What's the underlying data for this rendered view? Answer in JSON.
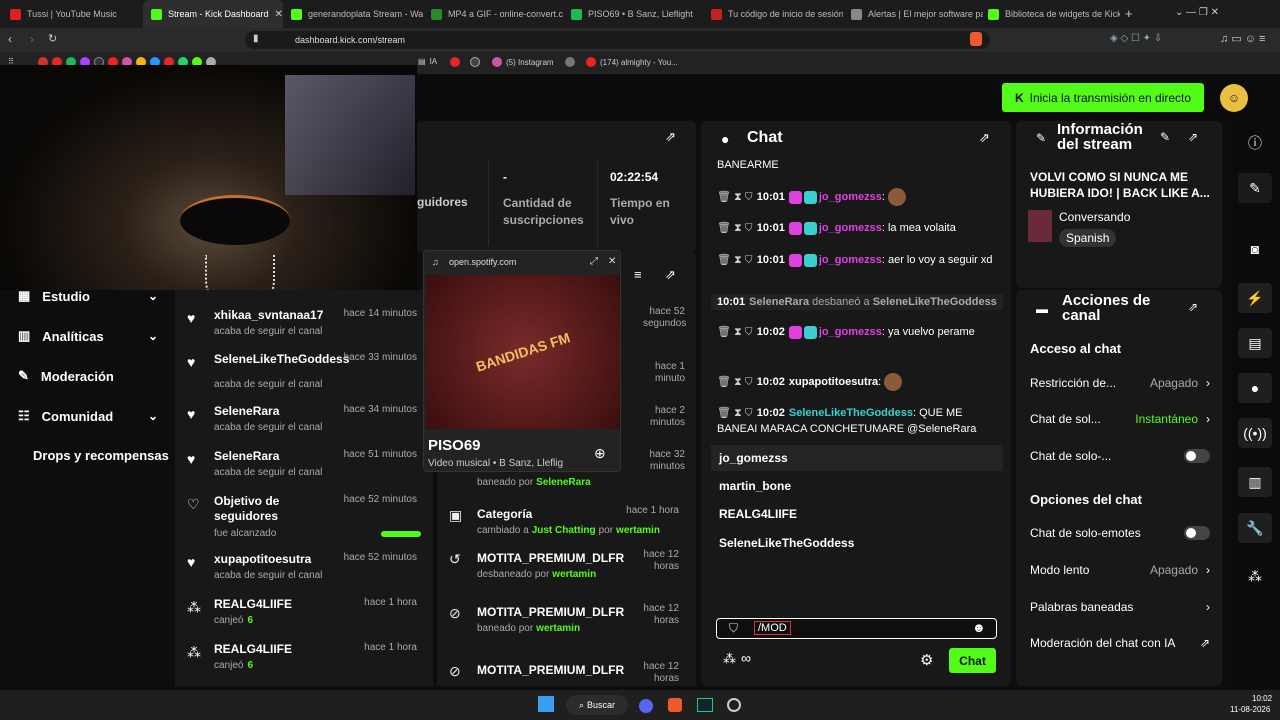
{
  "browser": {
    "tabs": [
      {
        "label": "Tussi | YouTube Music",
        "color": "#e02020"
      },
      {
        "label": "Stream - Kick Dashboard",
        "color": "#53fc18",
        "active": true
      },
      {
        "label": "generandoplata Stream - Wat",
        "color": "#53fc18"
      },
      {
        "label": "MP4 a GIF - online-convert.co",
        "color": "#2a8a2a"
      },
      {
        "label": "PISO69 • B Sanz, Lleflight",
        "color": "#1db954"
      },
      {
        "label": "Tu código de inicio de sesión",
        "color": "#c5221f"
      },
      {
        "label": "Alertas | El mejor software pa",
        "color": "#888888"
      },
      {
        "label": "Biblioteca de widgets de Kick",
        "color": "#53fc18"
      }
    ],
    "url": "dashboard.kick.com/stream",
    "bookmarks": [
      {
        "label": "IA"
      },
      {
        "label": "(5) Instagram"
      },
      {
        "label": "(174) almighty - You..."
      }
    ]
  },
  "topbar": {
    "go_live": "Inicia la transmisión en directo"
  },
  "sidebar": {
    "items": [
      {
        "label": "Estudio",
        "chev": "⌄"
      },
      {
        "label": "Analíticas",
        "chev": "⌄"
      },
      {
        "label": "Moderación",
        "chev": ""
      },
      {
        "label": "Comunidad",
        "chev": "⌄"
      },
      {
        "label": "Drops y recompensas",
        "chev": ""
      }
    ]
  },
  "stats": {
    "followers_label": "guidores",
    "subs_value": "-",
    "subs_label": "Cantidad de suscripciones",
    "live_value": "02:22:54",
    "live_label": "Tiempo en vivo"
  },
  "activity": [
    {
      "name": "xhikaa_svntanaa17",
      "time": "hace 14 minutos",
      "sub": "acaba de seguir el canal",
      "icon": "♥"
    },
    {
      "name": "SeleneLikeTheGoddess",
      "time": "hace 33 minutos",
      "sub": "acaba de seguir el canal",
      "icon": "♥"
    },
    {
      "name": "SeleneRara",
      "time": "hace 34 minutos",
      "sub": "acaba de seguir el canal",
      "icon": "♥"
    },
    {
      "name": "SeleneRara",
      "time": "hace 51 minutos",
      "sub": "acaba de seguir el canal",
      "icon": "♥"
    },
    {
      "name": "Objetivo de seguidores",
      "time": "hace 52 minutos",
      "sub": "fue alcanzado",
      "icon": "♡"
    },
    {
      "name": "xupapotitoesutra",
      "time": "hace 52 minutos",
      "sub": "acaba de seguir el canal",
      "icon": "♥"
    },
    {
      "name": "REALG4LIIFE",
      "time": "hace 1 hora",
      "sub": "canjeó",
      "num": "6",
      "icon": "⁂"
    },
    {
      "name": "REALG4LIIFE",
      "time": "hace 1 hora",
      "sub": "canjeó",
      "num": "6",
      "icon": "⁂"
    }
  ],
  "modlog": {
    "partial_times": [
      "hace 52 segundos",
      "hace 1 minuto",
      "hace 2 minutos",
      "hace 32 minutos"
    ],
    "banned_by": "baneado por",
    "banned_by_user": "SeleneRara",
    "items": [
      {
        "name": "Categoría",
        "time": "hace 1 hora",
        "sub1": "cambiado a",
        "sub2": "Just Chatting",
        "sub3": "por",
        "sub4": "wertamin",
        "icon": "▣"
      },
      {
        "name": "MOTITA_PREMIUM_DLFR",
        "time": "hace 12 horas",
        "sub1": "desbaneado por",
        "sub2": "wertamin",
        "icon": "↺"
      },
      {
        "name": "MOTITA_PREMIUM_DLFR",
        "time": "hace 12 horas",
        "sub1": "baneado por",
        "sub2": "wertamin",
        "icon": "⊘"
      },
      {
        "name": "MOTITA_PREMIUM_DLFR",
        "time": "hace 12 horas",
        "sub1": "",
        "sub2": "",
        "icon": "⊘"
      }
    ]
  },
  "pip": {
    "host": "open.spotify.com",
    "title": "PISO69",
    "subtitle": "Video musical • B Sanz, Lleflig",
    "art_text": "BANDIDAS FM"
  },
  "chat": {
    "title": "Chat",
    "messages": [
      {
        "time": "",
        "user": "",
        "text": "BANEARME"
      },
      {
        "time": "10:01",
        "user": "jo_gomezss",
        "text": ""
      },
      {
        "time": "10:01",
        "user": "jo_gomezss",
        "text": "la mea volaita"
      },
      {
        "time": "10:01",
        "user": "jo_gomezss",
        "text": "aer lo voy a seguir xd"
      },
      {
        "time": "10:01",
        "user": "SeleneRara",
        "text": "desbaneó a",
        "target": "SeleneLikeTheGoddess"
      },
      {
        "time": "10:02",
        "user": "jo_gomezss",
        "text": "ya vuelvo perame"
      },
      {
        "time": "10:02",
        "user": "xupapotitoesutra",
        "text": ""
      },
      {
        "time": "10:02",
        "user": "SeleneLikeTheGoddess",
        "text": "QUE ME BANEAI MARACA CONCHETUMARE @SeleneRara"
      }
    ],
    "suggestions": [
      "jo_gomezss",
      "martin_bone",
      "REALG4LIIFE",
      "SeleneLikeTheGoddess"
    ],
    "input_value": "/MOD",
    "send_label": "Chat",
    "infinity": "∞"
  },
  "info": {
    "title": "Información del stream",
    "stream_title": "VOLVI COMO SI NUNCA ME HUBIERA IDO! | BACK LIKE A...",
    "category": "Conversando",
    "language": "Spanish"
  },
  "actions": {
    "title": "Acciones de canal",
    "access_heading": "Acceso al chat",
    "rows1": [
      {
        "label": "Restricción de...",
        "value": "Apagado",
        "kind": "arrow"
      },
      {
        "label": "Chat de sol...",
        "value": "Instantáneo",
        "kind": "arrow",
        "green": true
      },
      {
        "label": "Chat de solo-...",
        "value": "",
        "kind": "toggle"
      }
    ],
    "options_heading": "Opciones del chat",
    "rows2": [
      {
        "label": "Chat de solo-emotes",
        "value": "",
        "kind": "toggle"
      },
      {
        "label": "Modo lento",
        "value": "Apagado",
        "kind": "arrow"
      },
      {
        "label": "Palabras baneadas",
        "value": "",
        "kind": "arrow"
      },
      {
        "label": "Moderación del chat con IA",
        "value": "",
        "kind": "external"
      }
    ]
  },
  "taskbar": {
    "search": "Buscar",
    "time": "10:02",
    "date": "11-08-2026"
  },
  "colors": {
    "accent": "#53fc18",
    "pink": "#e040e0",
    "teal": "#3ad0d0"
  }
}
